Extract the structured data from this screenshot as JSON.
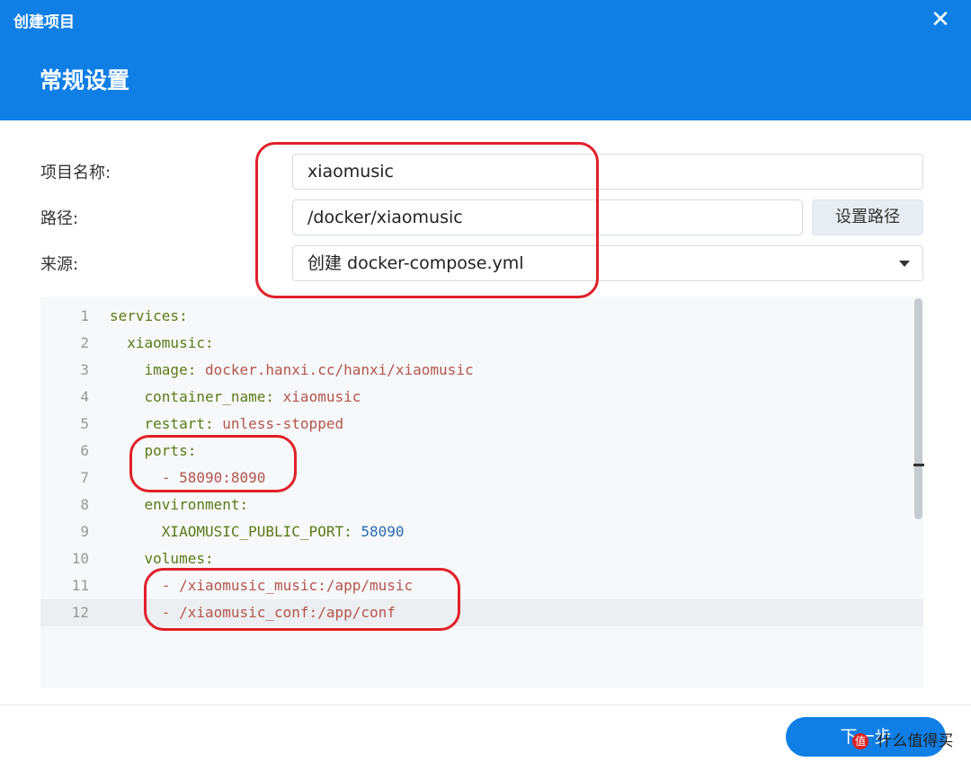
{
  "window": {
    "title": "创建项目",
    "section_title": "常规设置",
    "close_glyph": "✕"
  },
  "form": {
    "name_label": "项目名称:",
    "name_value": "xiaomusic",
    "path_label": "路径:",
    "path_value": "/docker/xiaomusic",
    "set_path_button": "设置路径",
    "source_label": "来源:",
    "source_value": "创建 docker-compose.yml"
  },
  "editor": {
    "lines": [
      {
        "num": "1",
        "indent": "",
        "key": "services:",
        "value": "",
        "value_type": ""
      },
      {
        "num": "2",
        "indent": "  ",
        "key": "xiaomusic:",
        "value": "",
        "value_type": ""
      },
      {
        "num": "3",
        "indent": "    ",
        "key": "image:",
        "value": " docker.hanxi.cc/hanxi/xiaomusic",
        "value_type": "s"
      },
      {
        "num": "4",
        "indent": "    ",
        "key": "container_name:",
        "value": " xiaomusic",
        "value_type": "s"
      },
      {
        "num": "5",
        "indent": "    ",
        "key": "restart:",
        "value": " unless-stopped",
        "value_type": "s"
      },
      {
        "num": "6",
        "indent": "    ",
        "key": "ports:",
        "value": "",
        "value_type": ""
      },
      {
        "num": "7",
        "indent": "      ",
        "key": "- ",
        "value": "58090:8090",
        "value_type": "s"
      },
      {
        "num": "8",
        "indent": "    ",
        "key": "environment:",
        "value": "",
        "value_type": ""
      },
      {
        "num": "9",
        "indent": "      ",
        "key": "XIAOMUSIC_PUBLIC_PORT:",
        "value": " 58090",
        "value_type": "n"
      },
      {
        "num": "10",
        "indent": "    ",
        "key": "volumes:",
        "value": "",
        "value_type": ""
      },
      {
        "num": "11",
        "indent": "      ",
        "key": "- ",
        "value": "/xiaomusic_music:/app/music",
        "value_type": "s"
      },
      {
        "num": "12",
        "indent": "      ",
        "key": "- ",
        "value": "/xiaomusic_conf:/app/conf",
        "value_type": "s"
      }
    ],
    "active_line": 12
  },
  "footer": {
    "next_button": "下一步"
  },
  "watermark": {
    "logo": "值",
    "text": "什么值得买"
  },
  "colors": {
    "header_bg": "#0f7fe6",
    "annotation": "#e0202a",
    "yaml_key": "#5b7a17",
    "yaml_string": "#b4554d",
    "yaml_number": "#2a6bb0"
  }
}
